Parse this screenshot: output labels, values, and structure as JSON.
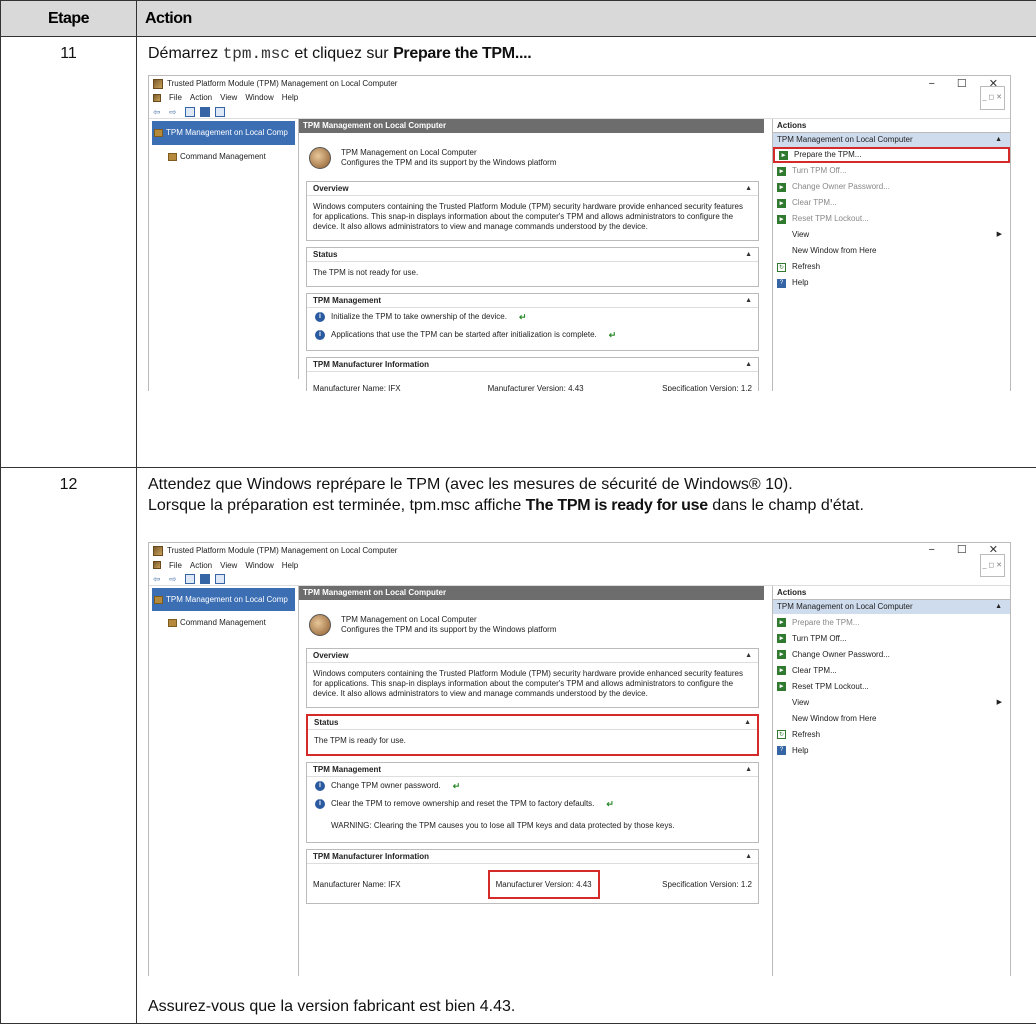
{
  "table": {
    "header_step": "Etape",
    "header_action": "Action"
  },
  "step11": {
    "number": "11",
    "text_before": "Démarrez ",
    "command": "tpm.msc",
    "text_middle": " et cliquez sur ",
    "bold": "Prepare the TPM...."
  },
  "step12": {
    "number": "12",
    "line1": "Attendez que Windows reprépare le TPM (avec les mesures de sécurité de Windows® 10).",
    "line2_before": "Lorsque la préparation est terminée, tpm.msc affiche ",
    "line2_bold": "The TPM is ready for use",
    "line2_after": " dans le champ d'état.",
    "footer": "Assurez-vous que la version fabricant est bien 4.43."
  },
  "window": {
    "title": "Trusted Platform Module (TPM) Management on Local Computer",
    "menu": [
      "File",
      "Action",
      "View",
      "Window",
      "Help"
    ],
    "tree_root": "TPM Management on Local Comp",
    "tree_child": "Command Management",
    "center_header": "TPM Management on Local Computer",
    "intro_title": "TPM Management on Local Computer",
    "intro_sub": "Configures the TPM and its support by the Windows platform",
    "overview_title": "Overview",
    "overview_text": "Windows computers containing the Trusted Platform Module (TPM) security hardware provide enhanced security features for applications. This snap-in displays information about the computer's TPM and allows administrators to configure the device. It also allows administrators to view and manage commands understood by the device.",
    "status_title": "Status",
    "mgmt_title": "TPM Management",
    "mfr_title": "TPM Manufacturer Information",
    "mfr_name": "Manufacturer Name:  IFX",
    "mfr_version": "Manufacturer Version:  4.43",
    "spec_version": "Specification Version:  1.2",
    "actions_title": "Actions",
    "actions_sub": "TPM Management on Local Computer",
    "actions": [
      "Prepare the TPM...",
      "Turn TPM Off...",
      "Change Owner Password...",
      "Clear TPM...",
      "Reset TPM Lockout...",
      "View",
      "New Window from Here",
      "Refresh",
      "Help"
    ]
  },
  "shot1": {
    "status_text": "The TPM is not ready for use.",
    "mgmt1": "Initialize the TPM to take ownership of the device.",
    "mgmt2": "Applications that use the TPM can be started after initialization is complete."
  },
  "shot2": {
    "status_text": "The TPM is ready for use.",
    "mgmt1": "Change TPM owner password.",
    "mgmt2": "Clear the TPM to remove ownership and reset the TPM to factory defaults.",
    "warning": "WARNING: Clearing the TPM causes you to lose all TPM keys and data protected by those keys."
  }
}
